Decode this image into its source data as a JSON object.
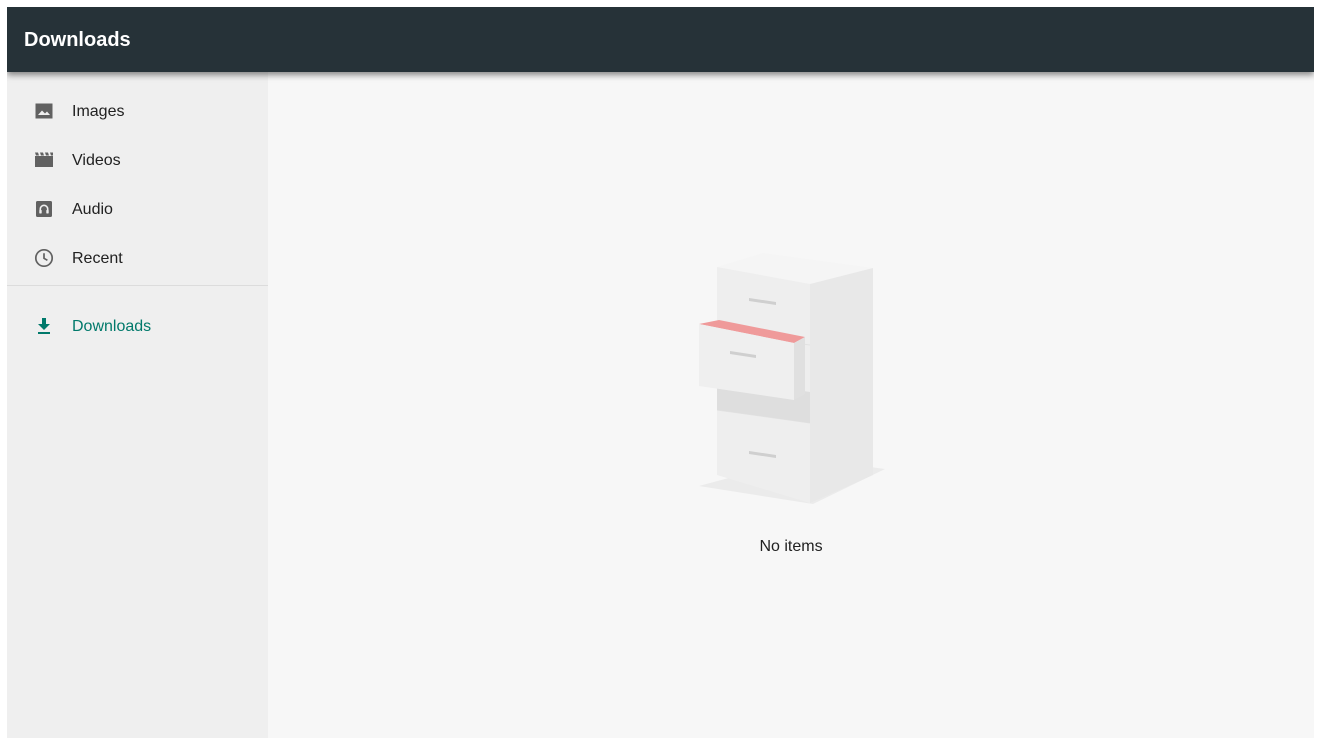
{
  "window": {
    "title": "Downloads"
  },
  "sidebar": {
    "items": [
      {
        "label": "Images",
        "icon": "image-icon"
      },
      {
        "label": "Videos",
        "icon": "movie-icon"
      },
      {
        "label": "Audio",
        "icon": "audio-icon"
      },
      {
        "label": "Recent",
        "icon": "clock-icon"
      }
    ],
    "roots": [
      {
        "label": "Downloads",
        "icon": "download-icon",
        "active": true
      }
    ]
  },
  "main": {
    "empty_message": "No items",
    "illustration": "file-cabinet-empty"
  },
  "colors": {
    "toolbar": "#263238",
    "accent": "#00796b",
    "sidebar_bg": "#efefef",
    "content_bg": "#f7f7f7",
    "drawer_inside": "#ef9a9a"
  }
}
